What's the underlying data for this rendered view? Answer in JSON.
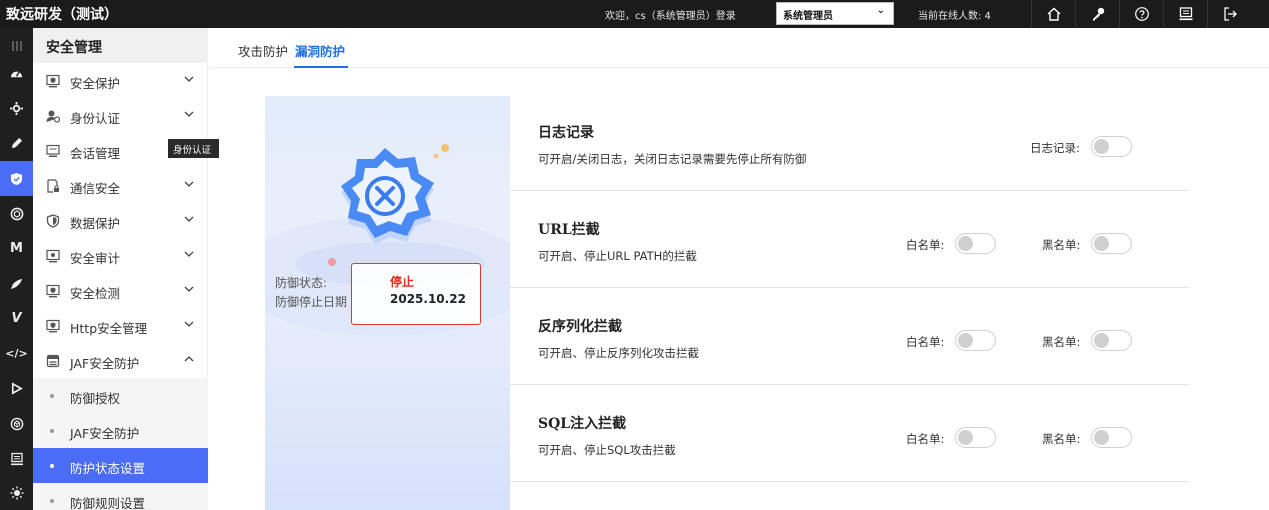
{
  "app": {
    "title": "致远研发（测试）"
  },
  "topbar": {
    "welcome": "欢迎，cs（系统管理员）登录",
    "role_selected": "系统管理员",
    "online_count": "当前在线人数: 4",
    "icons": [
      "home-icon",
      "key-icon",
      "help-icon",
      "monitor-icon",
      "logout-icon"
    ]
  },
  "rail": {
    "icons": [
      "menu-icon",
      "dashboard-icon",
      "settings-icon",
      "pen-icon",
      "shield-icon",
      "hexagon-icon",
      "m-icon",
      "brush-icon",
      "v-icon",
      "code-icon",
      "play-icon",
      "cube-icon",
      "monitor-icon",
      "sun-icon"
    ],
    "active_index": 4
  },
  "sidebar": {
    "title": "安全管理",
    "items": [
      {
        "label": "安全保护",
        "icon": "shield-monitor-icon",
        "chevron": "down"
      },
      {
        "label": "身份认证",
        "icon": "user-icon",
        "chevron": "down"
      },
      {
        "label": "会话管理",
        "icon": "session-icon",
        "chevron": ""
      },
      {
        "label": "通信安全",
        "icon": "lock-doc-icon",
        "chevron": "down"
      },
      {
        "label": "数据保护",
        "icon": "shield-icon",
        "chevron": "down"
      },
      {
        "label": "安全审计",
        "icon": "audit-icon",
        "chevron": "down"
      },
      {
        "label": "安全检测",
        "icon": "detect-icon",
        "chevron": "down"
      },
      {
        "label": "Http安全管理",
        "icon": "http-icon",
        "chevron": "down"
      },
      {
        "label": "JAF安全防护",
        "icon": "server-icon",
        "chevron": "up"
      }
    ],
    "subitems": [
      {
        "label": "防御授权",
        "active": false
      },
      {
        "label": "JAF安全防护",
        "active": false
      },
      {
        "label": "防护状态设置",
        "active": true
      },
      {
        "label": "防御规则设置",
        "active": false
      }
    ],
    "tooltip": "身份认证"
  },
  "tabs": [
    {
      "label": "攻击防护",
      "active": false
    },
    {
      "label": "漏洞防护",
      "active": true
    }
  ],
  "status_panel": {
    "status_label": "防御状态:",
    "stop_date_label": "防御停止日期",
    "status_value": "停止",
    "stop_date": "2025.10.22",
    "colors": {
      "stopped": "#e52a1c",
      "accent": "#4a6cf7"
    }
  },
  "features": [
    {
      "title": "日志记录",
      "desc": "可开启/关闭日志，关闭日志记录需要先停止所有防御",
      "switches": [
        {
          "label": "日志记录:",
          "on": false
        }
      ]
    },
    {
      "title": "URL拦截",
      "desc": "可开启、停止URL PATH的拦截",
      "switches": [
        {
          "label": "白名单:",
          "on": false
        },
        {
          "label": "黑名单:",
          "on": false
        }
      ]
    },
    {
      "title": "反序列化拦截",
      "desc": "可开启、停止反序列化攻击拦截",
      "switches": [
        {
          "label": "白名单:",
          "on": false
        },
        {
          "label": "黑名单:",
          "on": false
        }
      ]
    },
    {
      "title": "SQL注入拦截",
      "desc": "可开启、停止SQL攻击拦截",
      "switches": [
        {
          "label": "白名单:",
          "on": false
        },
        {
          "label": "黑名单:",
          "on": false
        }
      ]
    }
  ]
}
